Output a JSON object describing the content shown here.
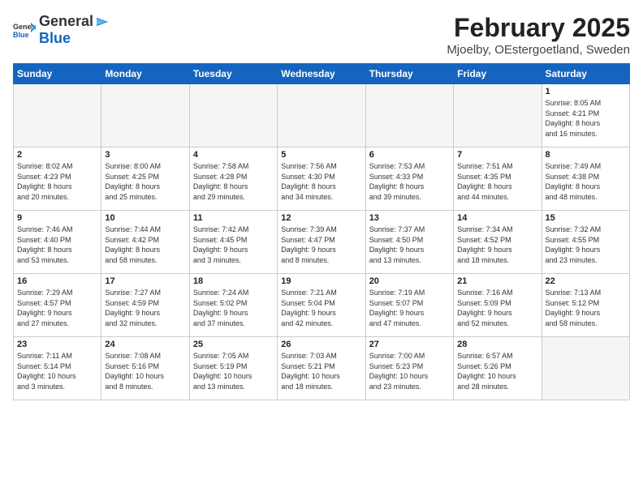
{
  "header": {
    "logo_general": "General",
    "logo_blue": "Blue",
    "month": "February 2025",
    "location": "Mjoelby, OEstergoetland, Sweden"
  },
  "weekdays": [
    "Sunday",
    "Monday",
    "Tuesday",
    "Wednesday",
    "Thursday",
    "Friday",
    "Saturday"
  ],
  "weeks": [
    [
      {
        "day": "",
        "info": ""
      },
      {
        "day": "",
        "info": ""
      },
      {
        "day": "",
        "info": ""
      },
      {
        "day": "",
        "info": ""
      },
      {
        "day": "",
        "info": ""
      },
      {
        "day": "",
        "info": ""
      },
      {
        "day": "1",
        "info": "Sunrise: 8:05 AM\nSunset: 4:21 PM\nDaylight: 8 hours\nand 16 minutes."
      }
    ],
    [
      {
        "day": "2",
        "info": "Sunrise: 8:02 AM\nSunset: 4:23 PM\nDaylight: 8 hours\nand 20 minutes."
      },
      {
        "day": "3",
        "info": "Sunrise: 8:00 AM\nSunset: 4:25 PM\nDaylight: 8 hours\nand 25 minutes."
      },
      {
        "day": "4",
        "info": "Sunrise: 7:58 AM\nSunset: 4:28 PM\nDaylight: 8 hours\nand 29 minutes."
      },
      {
        "day": "5",
        "info": "Sunrise: 7:56 AM\nSunset: 4:30 PM\nDaylight: 8 hours\nand 34 minutes."
      },
      {
        "day": "6",
        "info": "Sunrise: 7:53 AM\nSunset: 4:33 PM\nDaylight: 8 hours\nand 39 minutes."
      },
      {
        "day": "7",
        "info": "Sunrise: 7:51 AM\nSunset: 4:35 PM\nDaylight: 8 hours\nand 44 minutes."
      },
      {
        "day": "8",
        "info": "Sunrise: 7:49 AM\nSunset: 4:38 PM\nDaylight: 8 hours\nand 48 minutes."
      }
    ],
    [
      {
        "day": "9",
        "info": "Sunrise: 7:46 AM\nSunset: 4:40 PM\nDaylight: 8 hours\nand 53 minutes."
      },
      {
        "day": "10",
        "info": "Sunrise: 7:44 AM\nSunset: 4:42 PM\nDaylight: 8 hours\nand 58 minutes."
      },
      {
        "day": "11",
        "info": "Sunrise: 7:42 AM\nSunset: 4:45 PM\nDaylight: 9 hours\nand 3 minutes."
      },
      {
        "day": "12",
        "info": "Sunrise: 7:39 AM\nSunset: 4:47 PM\nDaylight: 9 hours\nand 8 minutes."
      },
      {
        "day": "13",
        "info": "Sunrise: 7:37 AM\nSunset: 4:50 PM\nDaylight: 9 hours\nand 13 minutes."
      },
      {
        "day": "14",
        "info": "Sunrise: 7:34 AM\nSunset: 4:52 PM\nDaylight: 9 hours\nand 18 minutes."
      },
      {
        "day": "15",
        "info": "Sunrise: 7:32 AM\nSunset: 4:55 PM\nDaylight: 9 hours\nand 23 minutes."
      }
    ],
    [
      {
        "day": "16",
        "info": "Sunrise: 7:29 AM\nSunset: 4:57 PM\nDaylight: 9 hours\nand 27 minutes."
      },
      {
        "day": "17",
        "info": "Sunrise: 7:27 AM\nSunset: 4:59 PM\nDaylight: 9 hours\nand 32 minutes."
      },
      {
        "day": "18",
        "info": "Sunrise: 7:24 AM\nSunset: 5:02 PM\nDaylight: 9 hours\nand 37 minutes."
      },
      {
        "day": "19",
        "info": "Sunrise: 7:21 AM\nSunset: 5:04 PM\nDaylight: 9 hours\nand 42 minutes."
      },
      {
        "day": "20",
        "info": "Sunrise: 7:19 AM\nSunset: 5:07 PM\nDaylight: 9 hours\nand 47 minutes."
      },
      {
        "day": "21",
        "info": "Sunrise: 7:16 AM\nSunset: 5:09 PM\nDaylight: 9 hours\nand 52 minutes."
      },
      {
        "day": "22",
        "info": "Sunrise: 7:13 AM\nSunset: 5:12 PM\nDaylight: 9 hours\nand 58 minutes."
      }
    ],
    [
      {
        "day": "23",
        "info": "Sunrise: 7:11 AM\nSunset: 5:14 PM\nDaylight: 10 hours\nand 3 minutes."
      },
      {
        "day": "24",
        "info": "Sunrise: 7:08 AM\nSunset: 5:16 PM\nDaylight: 10 hours\nand 8 minutes."
      },
      {
        "day": "25",
        "info": "Sunrise: 7:05 AM\nSunset: 5:19 PM\nDaylight: 10 hours\nand 13 minutes."
      },
      {
        "day": "26",
        "info": "Sunrise: 7:03 AM\nSunset: 5:21 PM\nDaylight: 10 hours\nand 18 minutes."
      },
      {
        "day": "27",
        "info": "Sunrise: 7:00 AM\nSunset: 5:23 PM\nDaylight: 10 hours\nand 23 minutes."
      },
      {
        "day": "28",
        "info": "Sunrise: 6:57 AM\nSunset: 5:26 PM\nDaylight: 10 hours\nand 28 minutes."
      },
      {
        "day": "",
        "info": ""
      }
    ]
  ]
}
